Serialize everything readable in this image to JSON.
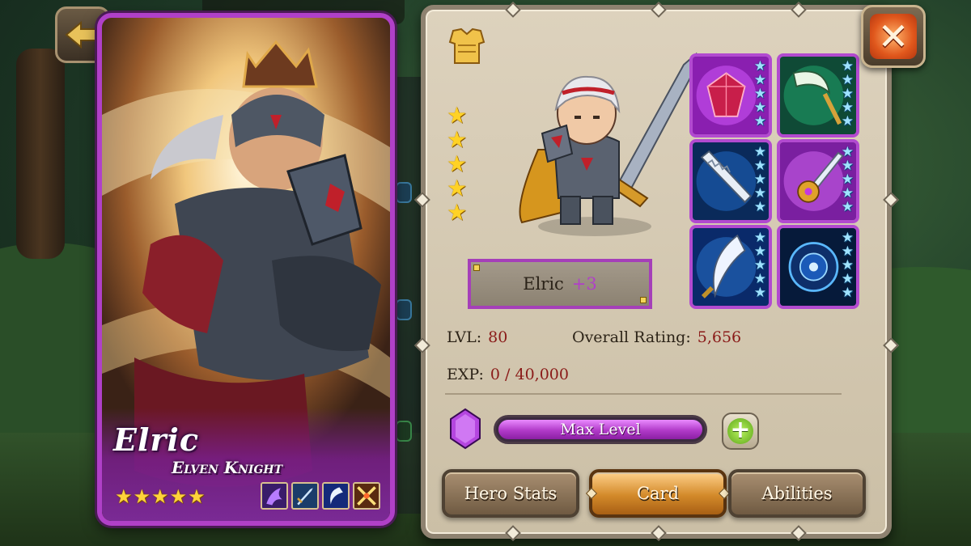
{
  "hero_card": {
    "name": "Elric",
    "class": "Elven Knight",
    "stars": [
      "★",
      "★",
      "★",
      "★",
      "★"
    ],
    "skills": [
      "shadow-skill-icon",
      "sword-skill-icon",
      "crescent-skill-icon",
      "cross-slash-skill-icon"
    ],
    "border_color": "#b040c8"
  },
  "detail": {
    "hero_stars": [
      "★",
      "★",
      "★",
      "★",
      "★"
    ],
    "name_plate": {
      "name": "Elric",
      "plus": "+3"
    },
    "level_label": "LVL:",
    "level_value": "80",
    "rating_label": "Overall Rating:",
    "rating_value": "5,656",
    "exp_label": "EXP:",
    "exp_value": "0 / 40,000",
    "level_bar_text": "Max Level",
    "level_progress": 1.0
  },
  "equipment": [
    {
      "name": "ruby-gem-icon",
      "stars": 5
    },
    {
      "name": "green-scythe-icon",
      "stars": 5
    },
    {
      "name": "serrated-blade-icon",
      "stars": 5
    },
    {
      "name": "golden-hilt-sword-icon",
      "stars": 5
    },
    {
      "name": "curved-dagger-icon",
      "stars": 5
    },
    {
      "name": "blue-orb-icon",
      "stars": 5
    }
  ],
  "tabs": [
    {
      "label": "Hero Stats",
      "active": false
    },
    {
      "label": "Card",
      "active": true
    },
    {
      "label": "Abilities",
      "active": false
    }
  ],
  "colors": {
    "accent_purple": "#b040c8",
    "value_red": "#8a1a18",
    "star_gold": "#ffd226",
    "star_blue": "#9fe2ff"
  }
}
